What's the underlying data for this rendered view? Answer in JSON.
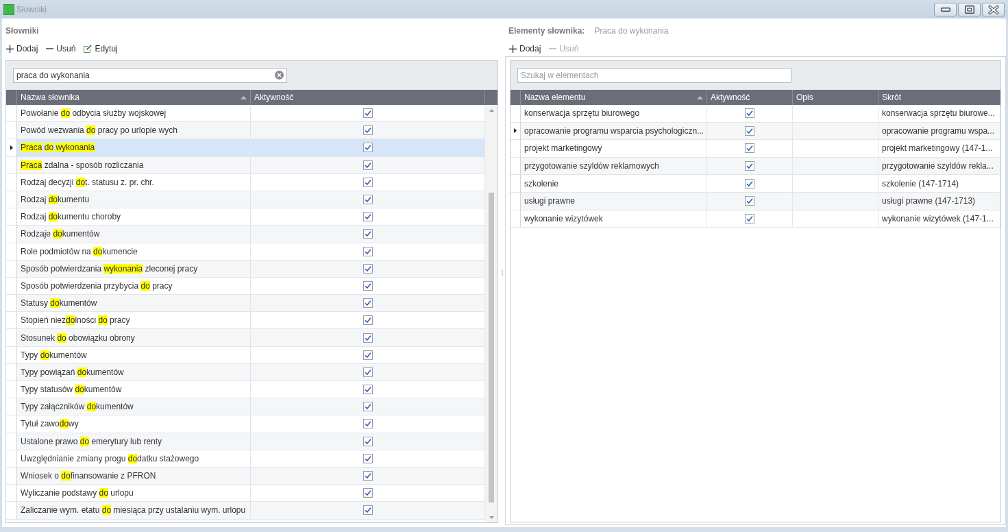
{
  "window": {
    "title": "Słowniki"
  },
  "dictionaries_panel": {
    "heading": "Słowniki",
    "toolbar": [
      {
        "kind": "add",
        "label": "Dodaj",
        "disabled": false
      },
      {
        "kind": "remove",
        "label": "Usuń",
        "disabled": false
      },
      {
        "kind": "edit",
        "label": "Edytuj",
        "disabled": false
      }
    ],
    "search": {
      "value": "praca do wykonania"
    },
    "table": {
      "focused": true,
      "columns": [
        {
          "label": "Nazwa słownika",
          "sorted": true
        },
        {
          "label": "Aktywność",
          "sorted": false
        }
      ],
      "rows": [
        {
          "name_parts": [
            {
              "text": "Powołanie ",
              "highlighted": false,
              "space_before": false
            },
            {
              "text": "do",
              "highlighted": true,
              "space_before": false
            },
            {
              "text": " odbycia służby wojskowej",
              "highlighted": false,
              "space_before": false
            }
          ],
          "active": true,
          "selected": false
        },
        {
          "name_parts": [
            {
              "text": "Powód wezwania ",
              "highlighted": false,
              "space_before": false
            },
            {
              "text": "do",
              "highlighted": true,
              "space_before": false
            },
            {
              "text": " pracy po urlopie wych",
              "highlighted": false,
              "space_before": false
            }
          ],
          "active": true,
          "selected": false
        },
        {
          "name_parts": [
            {
              "text": "Praca",
              "highlighted": true,
              "space_before": false
            },
            {
              "text": "do",
              "highlighted": true,
              "space_before": true
            },
            {
              "text": "wykonania",
              "highlighted": true,
              "space_before": true
            }
          ],
          "active": true,
          "selected": true
        },
        {
          "name_parts": [
            {
              "text": "Praca",
              "highlighted": true,
              "space_before": false
            },
            {
              "text": " zdalna - sposób rozliczania",
              "highlighted": false,
              "space_before": false
            }
          ],
          "active": true,
          "selected": false
        },
        {
          "name_parts": [
            {
              "text": "Rodzaj decyzji ",
              "highlighted": false,
              "space_before": false
            },
            {
              "text": "do",
              "highlighted": true,
              "space_before": false
            },
            {
              "text": "t. statusu z. pr. chr.",
              "highlighted": false,
              "space_before": false
            }
          ],
          "active": true,
          "selected": false
        },
        {
          "name_parts": [
            {
              "text": "Rodzaj ",
              "highlighted": false,
              "space_before": false
            },
            {
              "text": "do",
              "highlighted": true,
              "space_before": false
            },
            {
              "text": "kumentu",
              "highlighted": false,
              "space_before": false
            }
          ],
          "active": true,
          "selected": false
        },
        {
          "name_parts": [
            {
              "text": "Rodzaj ",
              "highlighted": false,
              "space_before": false
            },
            {
              "text": "do",
              "highlighted": true,
              "space_before": false
            },
            {
              "text": "kumentu choroby",
              "highlighted": false,
              "space_before": false
            }
          ],
          "active": true,
          "selected": false
        },
        {
          "name_parts": [
            {
              "text": "Rodzaje ",
              "highlighted": false,
              "space_before": false
            },
            {
              "text": "do",
              "highlighted": true,
              "space_before": false
            },
            {
              "text": "kumentów",
              "highlighted": false,
              "space_before": false
            }
          ],
          "active": true,
          "selected": false
        },
        {
          "name_parts": [
            {
              "text": "Role podmiotów na ",
              "highlighted": false,
              "space_before": false
            },
            {
              "text": "do",
              "highlighted": true,
              "space_before": false
            },
            {
              "text": "kumencie",
              "highlighted": false,
              "space_before": false
            }
          ],
          "active": true,
          "selected": false
        },
        {
          "name_parts": [
            {
              "text": "Sposób potwierdzania ",
              "highlighted": false,
              "space_before": false
            },
            {
              "text": "wykonania",
              "highlighted": true,
              "space_before": false
            },
            {
              "text": " zleconej pracy",
              "highlighted": false,
              "space_before": false
            }
          ],
          "active": true,
          "selected": false
        },
        {
          "name_parts": [
            {
              "text": "Sposób potwierdzenia przybycia ",
              "highlighted": false,
              "space_before": false
            },
            {
              "text": "do",
              "highlighted": true,
              "space_before": false
            },
            {
              "text": " pracy",
              "highlighted": false,
              "space_before": false
            }
          ],
          "active": true,
          "selected": false
        },
        {
          "name_parts": [
            {
              "text": "Statusy ",
              "highlighted": false,
              "space_before": false
            },
            {
              "text": "do",
              "highlighted": true,
              "space_before": false
            },
            {
              "text": "kumentów",
              "highlighted": false,
              "space_before": false
            }
          ],
          "active": true,
          "selected": false
        },
        {
          "name_parts": [
            {
              "text": "Stopień niez",
              "highlighted": false,
              "space_before": false
            },
            {
              "text": "do",
              "highlighted": true,
              "space_before": false
            },
            {
              "text": "lności ",
              "highlighted": false,
              "space_before": false
            },
            {
              "text": "do",
              "highlighted": true,
              "space_before": false
            },
            {
              "text": " pracy",
              "highlighted": false,
              "space_before": false
            }
          ],
          "active": true,
          "selected": false
        },
        {
          "name_parts": [
            {
              "text": "Stosunek ",
              "highlighted": false,
              "space_before": false
            },
            {
              "text": "do",
              "highlighted": true,
              "space_before": false
            },
            {
              "text": " obowiązku obrony",
              "highlighted": false,
              "space_before": false
            }
          ],
          "active": true,
          "selected": false
        },
        {
          "name_parts": [
            {
              "text": "Typy ",
              "highlighted": false,
              "space_before": false
            },
            {
              "text": "do",
              "highlighted": true,
              "space_before": false
            },
            {
              "text": "kumentów",
              "highlighted": false,
              "space_before": false
            }
          ],
          "active": true,
          "selected": false
        },
        {
          "name_parts": [
            {
              "text": "Typy powiązań ",
              "highlighted": false,
              "space_before": false
            },
            {
              "text": "do",
              "highlighted": true,
              "space_before": false
            },
            {
              "text": "kumentów",
              "highlighted": false,
              "space_before": false
            }
          ],
          "active": true,
          "selected": false
        },
        {
          "name_parts": [
            {
              "text": "Typy statusów ",
              "highlighted": false,
              "space_before": false
            },
            {
              "text": "do",
              "highlighted": true,
              "space_before": false
            },
            {
              "text": "kumentów",
              "highlighted": false,
              "space_before": false
            }
          ],
          "active": true,
          "selected": false
        },
        {
          "name_parts": [
            {
              "text": "Typy załączników ",
              "highlighted": false,
              "space_before": false
            },
            {
              "text": "do",
              "highlighted": true,
              "space_before": false
            },
            {
              "text": "kumentów",
              "highlighted": false,
              "space_before": false
            }
          ],
          "active": true,
          "selected": false
        },
        {
          "name_parts": [
            {
              "text": "Tytuł zawo",
              "highlighted": false,
              "space_before": false
            },
            {
              "text": "do",
              "highlighted": true,
              "space_before": false
            },
            {
              "text": "wy",
              "highlighted": false,
              "space_before": false
            }
          ],
          "active": true,
          "selected": false
        },
        {
          "name_parts": [
            {
              "text": "Ustalone prawo ",
              "highlighted": false,
              "space_before": false
            },
            {
              "text": "do",
              "highlighted": true,
              "space_before": false
            },
            {
              "text": " emerytury lub renty",
              "highlighted": false,
              "space_before": false
            }
          ],
          "active": true,
          "selected": false
        },
        {
          "name_parts": [
            {
              "text": "Uwzględnianie zmiany progu ",
              "highlighted": false,
              "space_before": false
            },
            {
              "text": "do",
              "highlighted": true,
              "space_before": false
            },
            {
              "text": "datku stażowego",
              "highlighted": false,
              "space_before": false
            }
          ],
          "active": true,
          "selected": false
        },
        {
          "name_parts": [
            {
              "text": "Wniosek o ",
              "highlighted": false,
              "space_before": false
            },
            {
              "text": "do",
              "highlighted": true,
              "space_before": false
            },
            {
              "text": "finansowanie z PFRON",
              "highlighted": false,
              "space_before": false
            }
          ],
          "active": true,
          "selected": false
        },
        {
          "name_parts": [
            {
              "text": "Wyliczanie podstawy ",
              "highlighted": false,
              "space_before": false
            },
            {
              "text": "do",
              "highlighted": true,
              "space_before": false
            },
            {
              "text": " urlopu",
              "highlighted": false,
              "space_before": false
            }
          ],
          "active": true,
          "selected": false
        },
        {
          "name_parts": [
            {
              "text": "Zaliczanie wym. etatu ",
              "highlighted": false,
              "space_before": false
            },
            {
              "text": "do",
              "highlighted": true,
              "space_before": false
            },
            {
              "text": " miesiąca przy ustalaniu wym. urlopu",
              "highlighted": false,
              "space_before": false
            }
          ],
          "active": true,
          "selected": false
        }
      ]
    }
  },
  "elements_panel": {
    "heading": "Elementy słownika:",
    "current_dictionary": "Praca do wykonania",
    "toolbar": [
      {
        "kind": "add",
        "label": "Dodaj",
        "disabled": false
      },
      {
        "kind": "remove",
        "label": "Usuń",
        "disabled": true
      }
    ],
    "search": {
      "placeholder": "Szukaj w elementach"
    },
    "table": {
      "focused": false,
      "columns": [
        {
          "label": "Nazwa elementu",
          "sorted": true
        },
        {
          "label": "Aktywność",
          "sorted": false
        },
        {
          "label": "Opis",
          "sorted": false
        },
        {
          "label": "Skrót",
          "sorted": false
        }
      ],
      "rows": [
        {
          "name": "konserwacja sprzętu biurowego",
          "active": true,
          "short": "konserwacja sprzętu biurowe...",
          "selected": false
        },
        {
          "name": "opracowanie programu wsparcia psychologiczn...",
          "active": true,
          "short": "opracowanie programu wspa...",
          "selected": true
        },
        {
          "name": "projekt marketingowy",
          "active": true,
          "short": "projekt marketingowy (147-1...",
          "selected": false
        },
        {
          "name": "przygotowanie szyldów reklamowych",
          "active": true,
          "short": "przygotowanie szyldów rekla...",
          "selected": false
        },
        {
          "name": "szkolenie",
          "active": true,
          "short": "szkolenie (147-1714)",
          "selected": false
        },
        {
          "name": "usługi prawne",
          "active": true,
          "short": "usługi prawne (147-1713)",
          "selected": false
        },
        {
          "name": "wykonanie wizytówek",
          "active": true,
          "short": "wykonanie wizytówek (147-1...",
          "selected": false
        }
      ]
    }
  }
}
